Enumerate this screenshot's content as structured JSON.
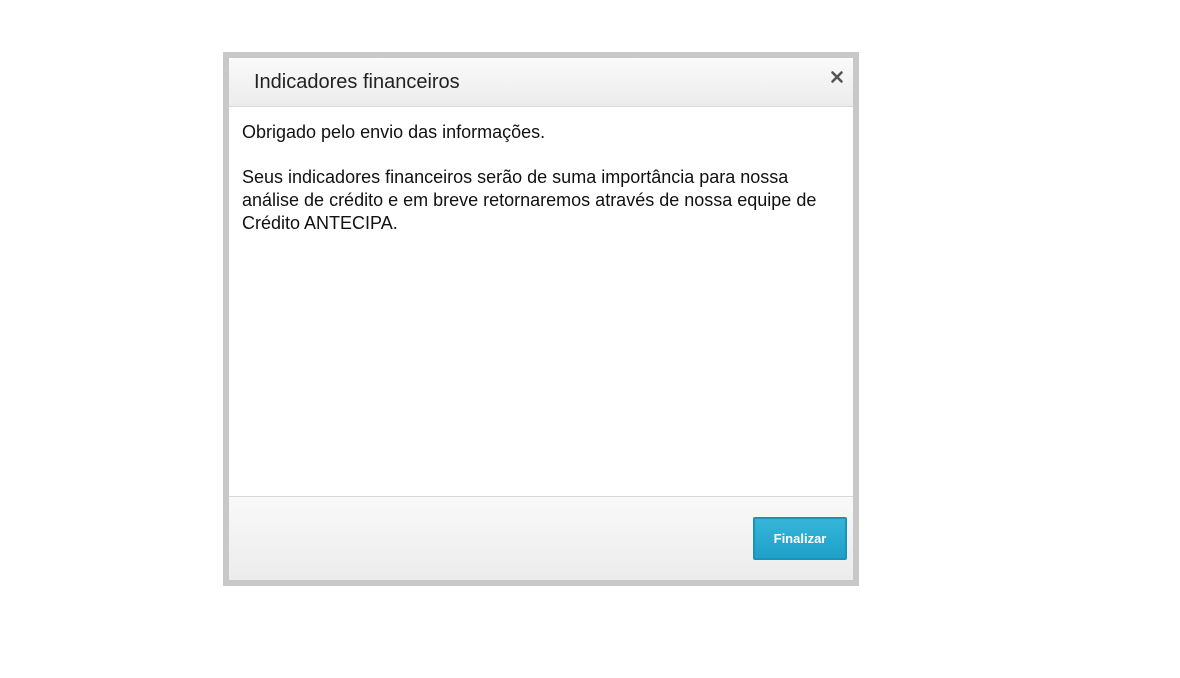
{
  "dialog": {
    "title": "Indicadores financeiros",
    "close_icon": "close-icon",
    "body": {
      "paragraph_1": "Obrigado pelo envio das informações.",
      "paragraph_2": "Seus indicadores financeiros serão de suma importância para nossa análise de crédito e em breve retornaremos através de nossa equipe de Crédito ANTECIPA."
    },
    "footer": {
      "finalize_label": "Finalizar"
    }
  },
  "colors": {
    "frame_border": "#c8c8c8",
    "button_primary": "#1ea0c9",
    "close_icon": "#555555"
  }
}
